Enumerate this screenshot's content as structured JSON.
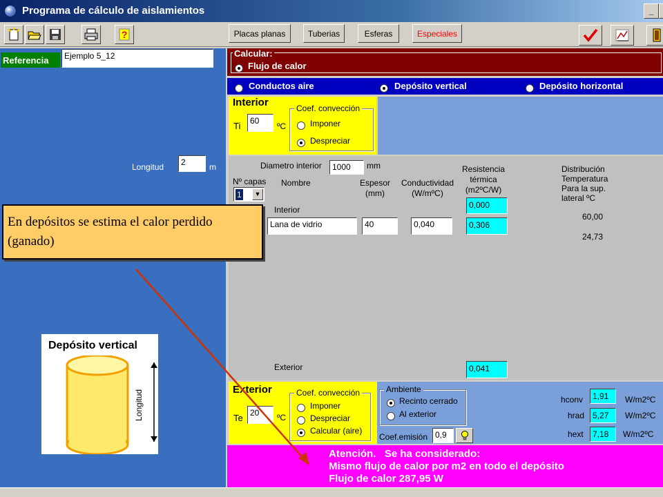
{
  "window": {
    "title": "Programa de cálculo de aislamientos",
    "minimize": "_",
    "maximize": "□"
  },
  "toolbar": {
    "tabs": [
      "Placas planas",
      "Tuberias",
      "Esferas",
      "Especiales"
    ],
    "active_tab_color": "#ff0000"
  },
  "referencia": {
    "label": "Referencia",
    "value": "Ejemplo 5_12"
  },
  "longitud": {
    "label": "Longitud",
    "value": "2",
    "unit": "m"
  },
  "calcular": {
    "legend": "Calcular:",
    "option": "Flujo de calor"
  },
  "types": [
    {
      "label": "Conductos aire",
      "selected": false
    },
    {
      "label": "Depósito vertical",
      "selected": true
    },
    {
      "label": "Depósito horizontal",
      "selected": false
    }
  ],
  "interior": {
    "title": "Interior",
    "ti_label": "Ti",
    "ti_value": "60",
    "ti_unit": "ºC",
    "conv_legend": "Coef. convección",
    "options": [
      {
        "label": "Imponer",
        "selected": false
      },
      {
        "label": "Despreciar",
        "selected": true
      }
    ]
  },
  "table": {
    "diam_label": "Diametro interior",
    "diam_value": "1000",
    "diam_unit": "mm",
    "ncapas_label": "Nº capas",
    "ncapas_value": "1",
    "col_nombre": "Nombre",
    "col_espesor": "Espesor (mm)",
    "col_conductividad": "Conductividad (W/mºC)",
    "col_resistencia": "Resistencia térmica (m2ºC/W)",
    "col_distribucion": "Distribución Temperatura Para la sup. lateral ºC",
    "interior_label": "Interior",
    "interior_resistance": "0,000",
    "layer_name": "Lana de vidrio",
    "layer_espesor": "40",
    "layer_conductividad": "0,040",
    "layer_resistance": "0,306",
    "temp_1": "60,00",
    "temp_2": "24,73",
    "exterior_label": "Exterior",
    "exterior_resistance": "0,041"
  },
  "exterior": {
    "title": "Exterior",
    "te_label": "Te",
    "te_value": "20",
    "te_unit": "ºC",
    "conv_legend": "Coef. convección",
    "options": [
      {
        "label": "Imponer",
        "selected": false
      },
      {
        "label": "Despreciar",
        "selected": false
      },
      {
        "label": "Calcular (aire)",
        "selected": true
      }
    ]
  },
  "ambiente": {
    "legend": "Ambiente",
    "options": [
      {
        "label": "Recinto cerrado",
        "selected": true
      },
      {
        "label": "Al exterior",
        "selected": false
      }
    ],
    "emision_label": "Coef.emisión",
    "emision_value": "0,9"
  },
  "coefs": [
    {
      "label": "hconv",
      "value": "1,91",
      "unit": "W/m2ºC"
    },
    {
      "label": "hrad",
      "value": "5,27",
      "unit": "W/m2ºC"
    },
    {
      "label": "hext",
      "value": "7,18",
      "unit": "W/m2ºC"
    }
  ],
  "atencion": {
    "line1": "Atención.   Se ha considerado:",
    "line2": "Mismo flujo de calor por m2 en todo el depósito",
    "line3": "Flujo de calor 287,95 W"
  },
  "callout": {
    "text": "En depósitos se estima el calor perdido (ganado)"
  },
  "diagram": {
    "title": "Depósito vertical",
    "axis_label": "Longitud"
  },
  "colors": {
    "left_panel": "#3a6ebe",
    "calc_bar": "#800000",
    "option_bar": "#0000c0",
    "yellow": "#ffff00",
    "magenta": "#ff00ff",
    "cyan": "#00ffff",
    "callout": "#ffcc66",
    "arrow": "#cc3300"
  }
}
